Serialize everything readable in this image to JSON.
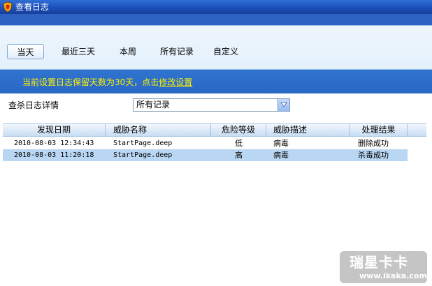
{
  "window": {
    "title": "查看日志"
  },
  "tabs": [
    {
      "label": "当天",
      "active": true
    },
    {
      "label": "最近三天",
      "active": false
    },
    {
      "label": "本周",
      "active": false
    },
    {
      "label": "所有记录",
      "active": false
    },
    {
      "label": "自定义",
      "active": false
    }
  ],
  "info": {
    "prefix": "当前设置日志保留天数为30天，点击",
    "link": "修改设置"
  },
  "filter": {
    "label": "查杀日志详情",
    "selected": "所有记录"
  },
  "table": {
    "columns": [
      "发现日期",
      "威胁名称",
      "危险等级",
      "威胁描述",
      "处理结果"
    ],
    "rows": [
      [
        "2010-08-03 12:34:43",
        "StartPage.deep",
        "低",
        "病毒",
        "删除成功"
      ],
      [
        "2010-08-03 11:20:18",
        "StartPage.deep",
        "高",
        "病毒",
        "杀毒成功"
      ]
    ],
    "selected_row": 1
  },
  "watermark": {
    "logo": "瑞星卡卡",
    "url": "www.ikaka.com"
  },
  "colors": {
    "title_bar": "#1c4fb8",
    "info_bar": "#2f74cf",
    "info_text": "#fff200",
    "selected_row": "#b9d6f3"
  }
}
